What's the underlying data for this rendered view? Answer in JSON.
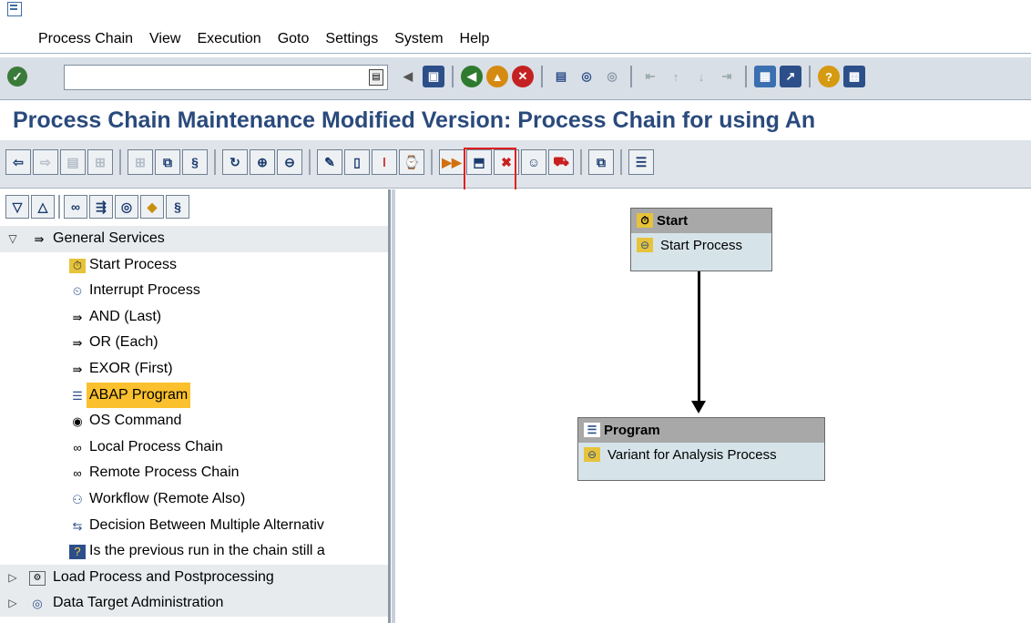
{
  "menu": [
    "Process Chain",
    "View",
    "Execution",
    "Goto",
    "Settings",
    "System",
    "Help"
  ],
  "command_field": {
    "value": ""
  },
  "title": "Process Chain Maintenance Modified Version: Process Chain for using An",
  "tree": {
    "group": "General Services",
    "items": [
      {
        "label": "Start Process",
        "icon": "start-process-icon"
      },
      {
        "label": "Interrupt Process",
        "icon": "interrupt-icon"
      },
      {
        "label": "AND (Last)",
        "icon": "and-icon"
      },
      {
        "label": "OR (Each)",
        "icon": "or-icon"
      },
      {
        "label": "EXOR (First)",
        "icon": "exor-icon"
      },
      {
        "label": "ABAP Program",
        "icon": "abap-program-icon",
        "selected": true
      },
      {
        "label": "OS Command",
        "icon": "os-command-icon"
      },
      {
        "label": "Local Process Chain",
        "icon": "local-chain-icon"
      },
      {
        "label": "Remote Process Chain",
        "icon": "remote-chain-icon"
      },
      {
        "label": "Workflow (Remote Also)",
        "icon": "workflow-icon"
      },
      {
        "label": "Decision Between Multiple Alternativ",
        "icon": "decision-icon"
      },
      {
        "label": "Is the previous run in the chain still a",
        "icon": "previous-run-icon"
      }
    ],
    "groups_collapsed": [
      {
        "label": "Load Process and Postprocessing",
        "icon": "load-process-icon"
      },
      {
        "label": "Data Target Administration",
        "icon": "data-target-icon"
      }
    ]
  },
  "canvas": {
    "start_node": {
      "title": "Start",
      "body": "Start Process"
    },
    "program_node": {
      "title": "Program",
      "body": "Variant for Analysis Process"
    }
  },
  "colors": {
    "title_blue": "#2a4a7c",
    "selection": "#fbc02d",
    "highlight_box": "#e02020",
    "node_body": "#d6e4ea",
    "node_header": "#a8a8a8"
  }
}
